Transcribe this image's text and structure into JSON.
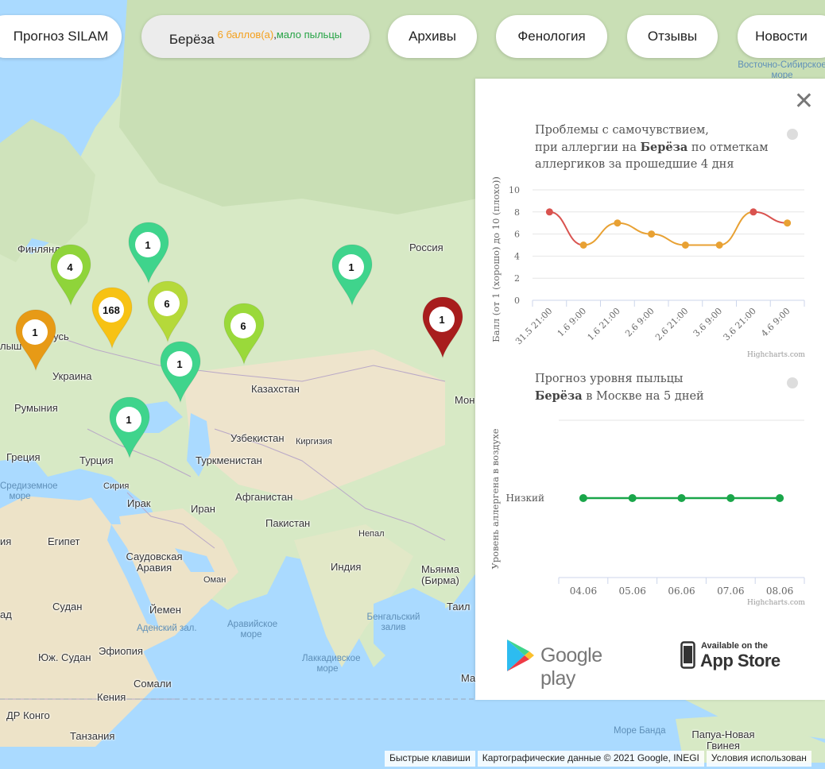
{
  "nav": {
    "forecast": "Прогноз SILAM",
    "plant_name": "Берёза",
    "plant_score": "6 баллов(а)",
    "plant_separator": ",",
    "plant_level": "мало пыльцы",
    "archives": "Архивы",
    "phenology": "Фенология",
    "reviews": "Отзывы",
    "news": "Новости"
  },
  "colors": {
    "score_orange": "#f4a01c",
    "level_green": "#26a345",
    "line_orange": "#e8a133",
    "line_red": "#d9534f",
    "forecast_green": "#1aa64a"
  },
  "map": {
    "labels": [
      "Финлянд",
      "Россия",
      "Беларусь",
      "лыш",
      "Украина",
      "Румыния",
      "Казахстан",
      "Узбекистан",
      "Киргизия",
      "Греция",
      "Турция",
      "Туркменистан",
      "Сирия",
      "Ирак",
      "Иран",
      "Афганистан",
      "Пакистан",
      "Непал",
      "Египет",
      "Индия",
      "Саудовская Аравия",
      "Оман",
      "Йемен",
      "Судан",
      "Эфиопия",
      "Юж. Судан",
      "Сомали",
      "Кения",
      "ДР Конго",
      "Танзания",
      "Мьянма (Бирма)",
      "Таил",
      "Мон",
      "Ма",
      "ия",
      "ад",
      "Папуа-Новая Гвинея",
      "Восточно-Сибирское море",
      "Аденский зал.",
      "Аравийское море",
      "Бенгальский залив",
      "Лаккадивское море",
      "Море Банда",
      "Средиземное море"
    ],
    "markers": [
      {
        "count": "4",
        "color": "#8fd43a"
      },
      {
        "count": "1",
        "color": "#3fd48c"
      },
      {
        "count": "168",
        "color": "#f7c214"
      },
      {
        "count": "6",
        "color": "#b5d93a"
      },
      {
        "count": "1",
        "color": "#e79a16"
      },
      {
        "count": "1",
        "color": "#3fd48c"
      },
      {
        "count": "6",
        "color": "#9ad93a"
      },
      {
        "count": "1",
        "color": "#3fd48c"
      },
      {
        "count": "1",
        "color": "#3fd48c"
      },
      {
        "count": "1",
        "color": "#a81d1d"
      }
    ]
  },
  "panel": {
    "close": "✕",
    "chart1_title": {
      "line1": "Проблемы с самочувствием,",
      "line2_pre": "при аллергии на ",
      "line2_bold": "Берёза",
      "line2_post": " по отметкам",
      "line3": "аллергиков за прошедшие 4 дня"
    },
    "chart1_credits": "Highcharts.com",
    "chart2_title": {
      "line1": "Прогноз уровня пыльцы",
      "line2_bold": "Берёза",
      "line2_post": " в Москве на 5 дней"
    },
    "chart2_credits": "Highcharts.com",
    "google_play": "Google play",
    "app_store_small": "Available on the",
    "app_store_big": "App Store"
  },
  "footer": {
    "shortcuts": "Быстрые клавиши",
    "map_data": "Картографические данные © 2021 Google, INEGI",
    "terms": "Условия использован"
  },
  "chart_data": [
    {
      "type": "line",
      "ylabel": "Балл (от 1 (хорошо) до 10 (плохо))",
      "categories": [
        "31.5 21:00",
        "1.6 9:00",
        "1.6 21:00",
        "2.6 9:00",
        "2.6 21:00",
        "3.6 9:00",
        "3.6 21:00",
        "4.6 9:00"
      ],
      "values": [
        8,
        5,
        7,
        6,
        5,
        5,
        8,
        7
      ],
      "ylim": [
        0,
        10
      ],
      "yticks": [
        "0",
        "2",
        "4",
        "6",
        "8",
        "10"
      ],
      "grid": true
    },
    {
      "type": "line",
      "ylabel": "Уровень аллергена в воздухе",
      "categories": [
        "04.06",
        "05.06",
        "06.06",
        "07.06",
        "08.06"
      ],
      "values": [
        "Низкий",
        "Низкий",
        "Низкий",
        "Низкий",
        "Низкий"
      ],
      "ycategories": [
        "Низкий"
      ]
    }
  ]
}
